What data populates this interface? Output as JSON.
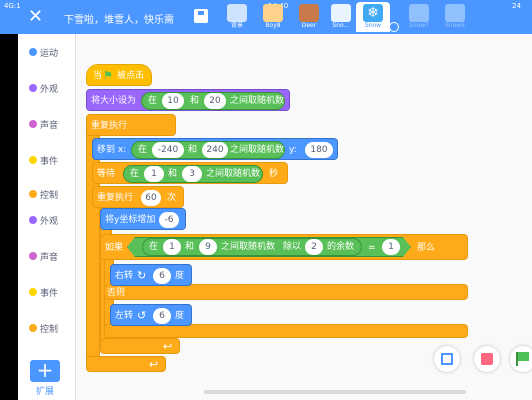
{
  "status": {
    "left_time": "4G:1",
    "right_time": "14:40",
    "battery": "24"
  },
  "header": {
    "project_title": "下雪啦，堆雪人，快乐需"
  },
  "sprites": [
    {
      "label": "背景",
      "color": "#cfe3ff"
    },
    {
      "label": "Boy8",
      "color": "#ffd28c"
    },
    {
      "label": "Deer",
      "color": "#c97a4a"
    },
    {
      "label": "Sno…",
      "color": "#e8f4ff"
    },
    {
      "label": "Snow",
      "color": "#3fa9f5"
    },
    {
      "label": "Snow7",
      "color": "#e6f3ff"
    },
    {
      "label": "Snow5",
      "color": "#e6f3ff"
    }
  ],
  "categories": [
    {
      "label": "运动",
      "color": "#4c97ff"
    },
    {
      "label": "外观",
      "color": "#9966ff"
    },
    {
      "label": "声音",
      "color": "#cf63cf"
    },
    {
      "label": "事件",
      "color": "#ffd500"
    },
    {
      "label": "控制",
      "color": "#ffab19"
    },
    {
      "label": "外观",
      "color": "#9966ff"
    },
    {
      "label": "声音",
      "color": "#cf63cf"
    },
    {
      "label": "事件",
      "color": "#ffd500"
    },
    {
      "label": "控制",
      "color": "#ffab19"
    }
  ],
  "extension": {
    "label": "扩展",
    "icon": "plus-icon"
  },
  "blocks": {
    "when_flag": {
      "prefix": "当",
      "suffix": "被点击"
    },
    "set_size": {
      "text": "将大小设为",
      "in": "在",
      "a": "10",
      "and": "和",
      "b": "20",
      "between": "之间取随机数"
    },
    "forever": {
      "text": "重复执行"
    },
    "goto": {
      "text": "移到 x:",
      "in": "在",
      "a": "-240",
      "and": "和",
      "b": "240",
      "between": "之间取随机数",
      "y": "y:",
      "yval": "180"
    },
    "wait": {
      "text": "等待",
      "in": "在",
      "a": "1",
      "and": "和",
      "b": "3",
      "between": "之间取随机数",
      "unit": "秒"
    },
    "repeat": {
      "text": "重复执行",
      "count": "60",
      "unit": "次"
    },
    "change_y": {
      "text": "将y坐标增加",
      "val": "-6"
    },
    "if": {
      "text": "如果",
      "in": "在",
      "a": "1",
      "and": "和",
      "b": "9",
      "between": "之间取随机数",
      "mod": "除以",
      "div": "2",
      "rem": "的余数",
      "eq": "=",
      "target": "1",
      "then": "那么"
    },
    "turn_right": {
      "text": "右转",
      "val": "6",
      "unit": "度"
    },
    "else": {
      "text": "否则"
    },
    "turn_left": {
      "text": "左转",
      "val": "6",
      "unit": "度"
    }
  }
}
